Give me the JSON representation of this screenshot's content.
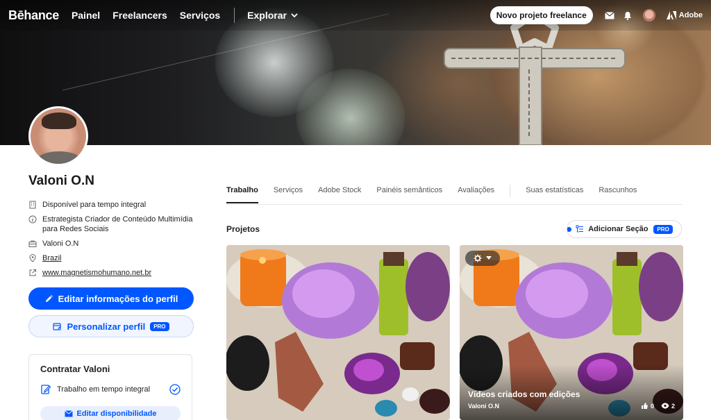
{
  "brand": {
    "logo": "Bēhance",
    "adobe": "Adobe"
  },
  "nav": {
    "items": [
      "Painel",
      "Freelancers",
      "Serviços"
    ],
    "explore": "Explorar",
    "freelance_button": "Novo projeto freelance"
  },
  "profile": {
    "name": "Valoni O.N",
    "availability": "Disponível para tempo integral",
    "role": "Estrategista Criador de Conteúdo Multimídia para Redes Sociais",
    "company": "Valoni O.N",
    "location": "Brazil",
    "website": "www.magnetismohumano.net.br",
    "edit_button": "Editar informações do perfil",
    "customize_button": "Personalizar perfil",
    "pro_badge": "PRO"
  },
  "hire": {
    "title": "Contratar Valoni",
    "item": "Trabalho em tempo integral",
    "button": "Editar disponibilidade"
  },
  "tabs": [
    "Trabalho",
    "Serviços",
    "Adobe Stock",
    "Painéis semânticos",
    "Avaliações",
    "Suas estatísticas",
    "Rascunhos"
  ],
  "projects": {
    "label": "Projetos",
    "add_section": "Adicionar Seção",
    "pro_badge": "PRO",
    "cards": [
      {
        "title": "",
        "author": "",
        "likes": "",
        "views": ""
      },
      {
        "title": "Vídeos criados com edições",
        "author": "Valoni O.N",
        "likes": "0",
        "views": "2"
      }
    ]
  },
  "colors": {
    "accent": "#0057ff",
    "text": "#191919"
  }
}
